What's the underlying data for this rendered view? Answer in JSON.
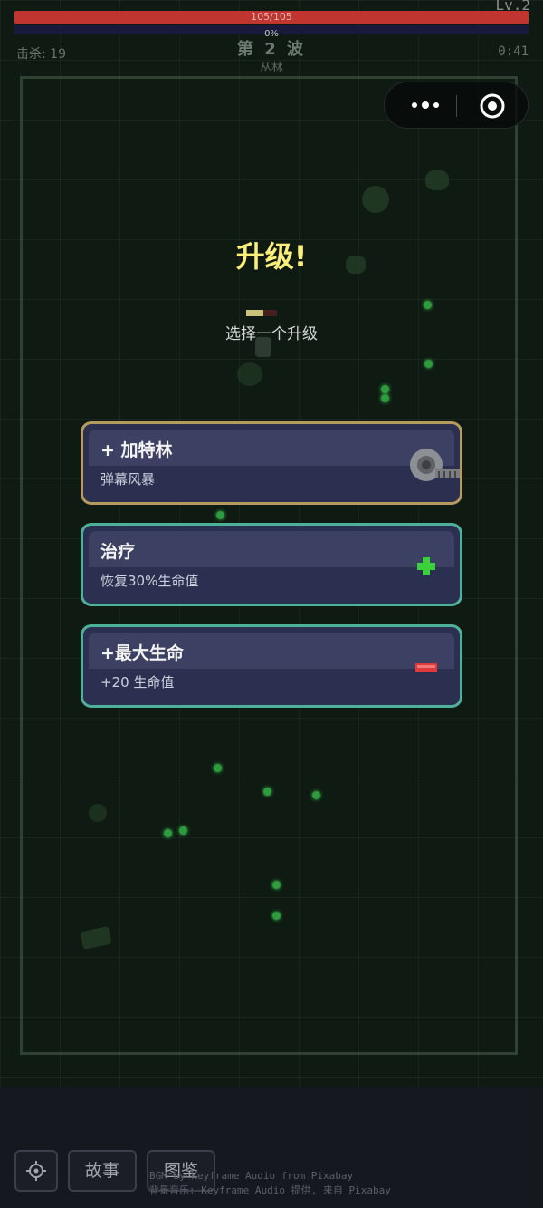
{
  "hud": {
    "level": "Lv.2",
    "hp_text": "105/105",
    "hp_fraction": 1.0,
    "xp_text": "0%",
    "xp_fraction": 0.0,
    "kills": "击杀: 19",
    "wave": "第 2 波",
    "zone": "丛林",
    "timer": "0:41"
  },
  "capsule": {
    "menu_icon": "more-dots-icon",
    "close_icon": "target-circle-icon"
  },
  "levelup": {
    "title": "升级!",
    "subtitle": "选择一个升级"
  },
  "choices": [
    {
      "name": "+  加特林",
      "desc": "弹幕风暴",
      "icon": "gatling-gun-icon",
      "border_color": "#b69a5e"
    },
    {
      "name": "治疗",
      "desc": "恢复30%生命值",
      "icon": "green-plus-icon",
      "border_color": "#4fb09a"
    },
    {
      "name": "+最大生命",
      "desc": "+20  生命值",
      "icon": "red-bar-icon",
      "border_color": "#4fb09a"
    }
  ],
  "bottom": {
    "settings_icon": "gear-icon",
    "story_label": "故事",
    "codex_label": "图鉴",
    "credits_line1": "BGM by Keyframe Audio from Pixabay",
    "credits_line2": "背景音乐: Keyframe Audio 提供, 来自 Pixabay"
  },
  "colors": {
    "hp_bar": "#c0352f",
    "title": "#fbef79",
    "gold_border": "#b69a5e",
    "teal_border": "#4fb09a"
  }
}
